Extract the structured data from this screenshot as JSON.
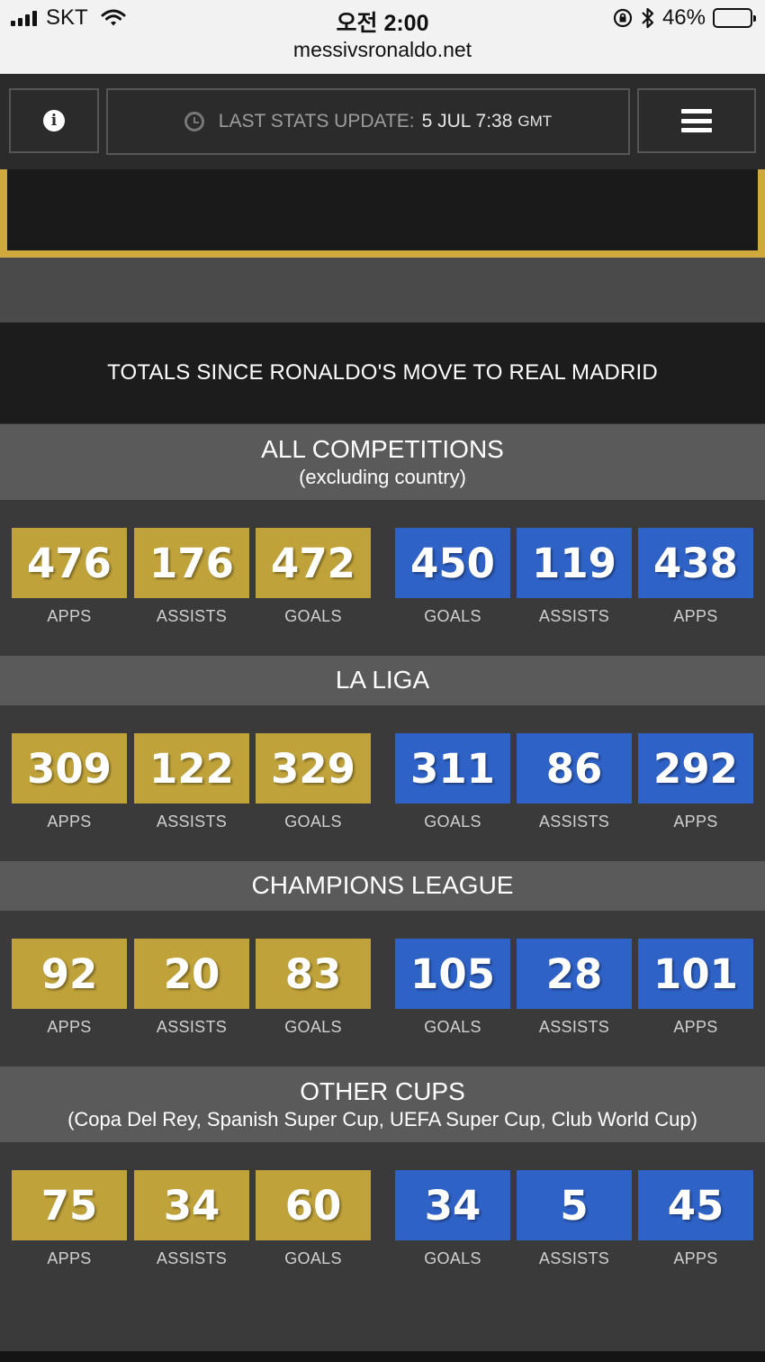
{
  "status_bar": {
    "carrier": "SKT",
    "time": "오전 2:00",
    "url": "messivsronaldo.net",
    "battery": "46%"
  },
  "nav": {
    "update_label": "LAST STATS UPDATE:",
    "update_value": "5 JUL 7:38",
    "update_tz": "GMT",
    "info_icon": "i"
  },
  "banner": {
    "heading": "TOTALS SINCE RONALDO'S MOVE TO REAL MADRID"
  },
  "sections": [
    {
      "title": "ALL COMPETITIONS",
      "subtitle": "(excluding country)",
      "messi": [
        {
          "value": "476",
          "label": "APPS"
        },
        {
          "value": "176",
          "label": "ASSISTS"
        },
        {
          "value": "472",
          "label": "GOALS"
        }
      ],
      "ronaldo": [
        {
          "value": "450",
          "label": "GOALS"
        },
        {
          "value": "119",
          "label": "ASSISTS"
        },
        {
          "value": "438",
          "label": "APPS"
        }
      ]
    },
    {
      "title": "LA LIGA",
      "subtitle": "",
      "messi": [
        {
          "value": "309",
          "label": "APPS"
        },
        {
          "value": "122",
          "label": "ASSISTS"
        },
        {
          "value": "329",
          "label": "GOALS"
        }
      ],
      "ronaldo": [
        {
          "value": "311",
          "label": "GOALS"
        },
        {
          "value": "86",
          "label": "ASSISTS"
        },
        {
          "value": "292",
          "label": "APPS"
        }
      ]
    },
    {
      "title": "CHAMPIONS LEAGUE",
      "subtitle": "",
      "messi": [
        {
          "value": "92",
          "label": "APPS"
        },
        {
          "value": "20",
          "label": "ASSISTS"
        },
        {
          "value": "83",
          "label": "GOALS"
        }
      ],
      "ronaldo": [
        {
          "value": "105",
          "label": "GOALS"
        },
        {
          "value": "28",
          "label": "ASSISTS"
        },
        {
          "value": "101",
          "label": "APPS"
        }
      ]
    },
    {
      "title": "OTHER CUPS",
      "subtitle": "(Copa Del Rey, Spanish Super Cup, UEFA Super Cup, Club World Cup)",
      "messi": [
        {
          "value": "75",
          "label": "APPS"
        },
        {
          "value": "34",
          "label": "ASSISTS"
        },
        {
          "value": "60",
          "label": "GOALS"
        }
      ],
      "ronaldo": [
        {
          "value": "34",
          "label": "GOALS"
        },
        {
          "value": "5",
          "label": "ASSISTS"
        },
        {
          "value": "45",
          "label": "APPS"
        }
      ]
    }
  ],
  "colors": {
    "messi": "#bfa23a",
    "ronaldo": "#2f62c7",
    "frame": "#d0a93e"
  }
}
